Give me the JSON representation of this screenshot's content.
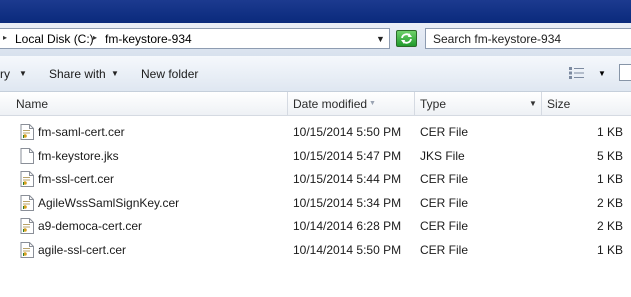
{
  "address": {
    "crumbs": [
      "Local Disk (C:)",
      "fm-keystore-934"
    ]
  },
  "search": {
    "placeholder": "Search fm-keystore-934"
  },
  "toolbar": {
    "organize_label": "ry",
    "share_label": "Share with",
    "new_folder_label": "New folder"
  },
  "columns": {
    "name": "Name",
    "date": "Date modified",
    "type": "Type",
    "size": "Size"
  },
  "files": [
    {
      "name": "fm-saml-cert.cer",
      "date": "10/15/2014 5:50 PM",
      "type": "CER File",
      "size": "1 KB",
      "icon": "certificate-file-icon"
    },
    {
      "name": "fm-keystore.jks",
      "date": "10/15/2014 5:47 PM",
      "type": "JKS File",
      "size": "5 KB",
      "icon": "blank-file-icon"
    },
    {
      "name": "fm-ssl-cert.cer",
      "date": "10/15/2014 5:44 PM",
      "type": "CER File",
      "size": "1 KB",
      "icon": "certificate-file-icon"
    },
    {
      "name": "AgileWssSamlSignKey.cer",
      "date": "10/15/2014 5:34 PM",
      "type": "CER File",
      "size": "2 KB",
      "icon": "certificate-file-icon"
    },
    {
      "name": "a9-democa-cert.cer",
      "date": "10/14/2014 6:28 PM",
      "type": "CER File",
      "size": "2 KB",
      "icon": "certificate-file-icon"
    },
    {
      "name": "agile-ssl-cert.cer",
      "date": "10/14/2014 5:50 PM",
      "type": "CER File",
      "size": "1 KB",
      "icon": "certificate-file-icon"
    }
  ]
}
